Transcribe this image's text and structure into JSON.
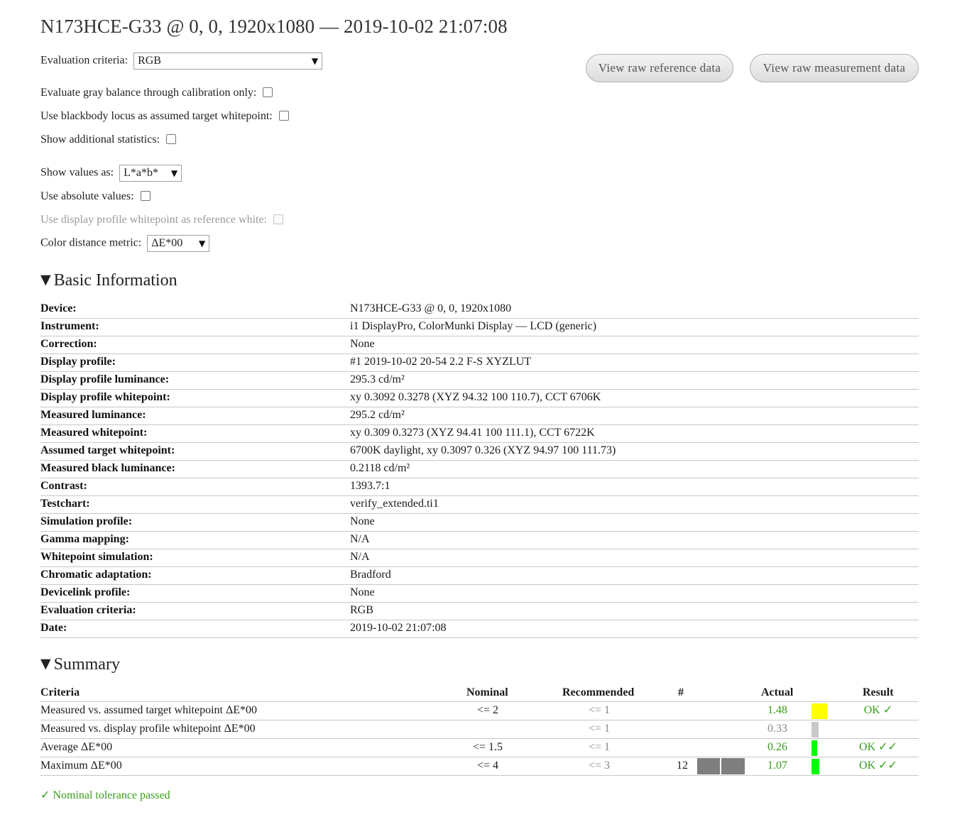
{
  "title": "N173HCE-G33 @ 0, 0, 1920x1080 — 2019-10-02 21:07:08",
  "options": {
    "evaluation_criteria_label": "Evaluation criteria:",
    "evaluation_criteria_value": "RGB",
    "gray_balance_label": "Evaluate gray balance through calibration only:",
    "blackbody_label": "Use blackbody locus as assumed target whitepoint:",
    "additional_stats_label": "Show additional statistics:",
    "show_values_label": "Show values as:",
    "show_values_value": "L*a*b*",
    "absolute_values_label": "Use absolute values:",
    "display_profile_white_label": "Use display profile whitepoint as reference white:",
    "color_metric_label": "Color distance metric:",
    "color_metric_value": "ΔE*00"
  },
  "buttons": {
    "raw_reference": "View raw reference data",
    "raw_measurement": "View raw measurement data"
  },
  "basic_info": {
    "title": "Basic Information",
    "rows": [
      {
        "k": "Device:",
        "v": "N173HCE-G33 @ 0, 0, 1920x1080"
      },
      {
        "k": "Instrument:",
        "v": "i1 DisplayPro, ColorMunki Display — LCD (generic)"
      },
      {
        "k": "Correction:",
        "v": "None"
      },
      {
        "k": "Display profile:",
        "v": "#1 2019-10-02 20-54 2.2 F-S XYZLUT"
      },
      {
        "k": "Display profile luminance:",
        "v": "295.3 cd/m²"
      },
      {
        "k": "Display profile whitepoint:",
        "v": "xy 0.3092 0.3278 (XYZ 94.32 100 110.7), CCT 6706K"
      },
      {
        "k": "Measured luminance:",
        "v": "295.2 cd/m²"
      },
      {
        "k": "Measured whitepoint:",
        "v": "xy 0.309 0.3273 (XYZ 94.41 100 111.1), CCT 6722K"
      },
      {
        "k": "Assumed target whitepoint:",
        "v": "6700K daylight, xy 0.3097 0.326 (XYZ 94.97 100 111.73)"
      },
      {
        "k": "Measured black luminance:",
        "v": "0.2118 cd/m²"
      },
      {
        "k": "Contrast:",
        "v": "1393.7:1"
      },
      {
        "k": "Testchart:",
        "v": "verify_extended.ti1"
      },
      {
        "k": "Simulation profile:",
        "v": "None"
      },
      {
        "k": "Gamma mapping:",
        "v": "N/A"
      },
      {
        "k": "Whitepoint simulation:",
        "v": "N/A"
      },
      {
        "k": "Chromatic adaptation:",
        "v": "Bradford"
      },
      {
        "k": "Devicelink profile:",
        "v": "None"
      },
      {
        "k": "Evaluation criteria:",
        "v": "RGB"
      },
      {
        "k": "Date:",
        "v": "2019-10-02 21:07:08"
      }
    ]
  },
  "summary": {
    "title": "Summary",
    "headers": {
      "criteria": "Criteria",
      "nominal": "Nominal",
      "recommended": "Recommended",
      "count": "#",
      "actual": "Actual",
      "result": "Result"
    },
    "rows": [
      {
        "criteria": "Measured vs. assumed target whitepoint ΔE*00",
        "nominal": "<= 2",
        "recommended": "<= 1",
        "count": "",
        "actual": "1.48",
        "bar_color": "#ffff00",
        "bar_fraction": 0.74,
        "result": "OK ✓"
      },
      {
        "criteria": "Measured vs. display profile whitepoint ΔE*00",
        "nominal": "",
        "recommended": "<= 1",
        "count": "",
        "actual": "0.33",
        "bar_color": "#c8c8c8",
        "bar_fraction": 0.33,
        "result": ""
      },
      {
        "criteria": "Average ΔE*00",
        "nominal": "<= 1.5",
        "recommended": "<= 1",
        "count": "",
        "actual": "0.26",
        "bar_color": "#00ff00",
        "bar_fraction": 0.26,
        "result": "OK ✓✓"
      },
      {
        "criteria": "Maximum ΔE*00",
        "nominal": "<= 4",
        "recommended": "<= 3",
        "count": "12",
        "actual": "1.07",
        "bar_color": "#00ff00",
        "bar_fraction": 0.36,
        "result": "OK ✓✓"
      }
    ],
    "passed": "✓ Nominal tolerance passed"
  }
}
